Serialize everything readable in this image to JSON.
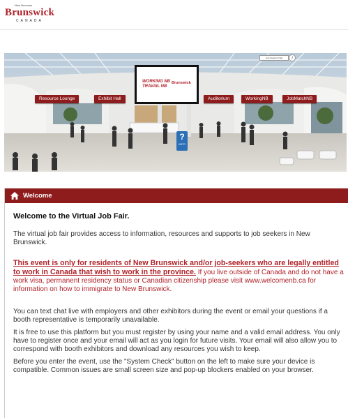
{
  "header": {
    "logo_tagline": "New Nouveau",
    "logo_brand": "Brunswick",
    "logo_sub": "CANADA"
  },
  "scene": {
    "booths": {
      "resource_lounge": "Resource Lounge",
      "exhibit_hall": "Exhibit Hall",
      "auditorium": "Auditorium",
      "working_nb": "WorkingNB",
      "jobmatch_nb": "JobMatchNB"
    },
    "screen": {
      "line1": "WORKING NB",
      "line2": "TRAVAIL NB",
      "brand": "Brunswick"
    },
    "info_kiosk": {
      "symbol": "?",
      "label": "INFO"
    },
    "corner_note": "Live Support Chat"
  },
  "welcome": {
    "header_title": "Welcome",
    "heading": "Welcome to the Virtual Job Fair.",
    "intro": "The virtual job fair provides access to information, resources and supports to job seekers in New Brunswick.",
    "residency_bold": "This event is only for residents of New Brunswick and/or job-seekers who are legally entitled to work in Canada that wish to work in the province.",
    "residency_rest": " If you live outside of Canada and do not have a work visa, permanent residency status or Canadian citizenship please visit www.welcomenb.ca for information on how to immigrate to New Brunswick.",
    "chat": "You can text chat live with employers and other exhibitors during the event or email your questions if a booth representative is temporarily unavailable.",
    "register": "It is free to use this platform but you must register by using your name and a valid email address. You only have to register once and your email will act as you login for future visits. Your email will also allow you to correspond with booth exhibitors and download any resources you wish to keep.",
    "system_check": "Before you enter the event, use the \"System Check\" button on the left to make sure your device is compatible. Common issues are small screen size and pop-up blockers enabled on your browser."
  },
  "colors": {
    "header_red": "#8f1c1c",
    "notice_red": "#b0232a"
  }
}
